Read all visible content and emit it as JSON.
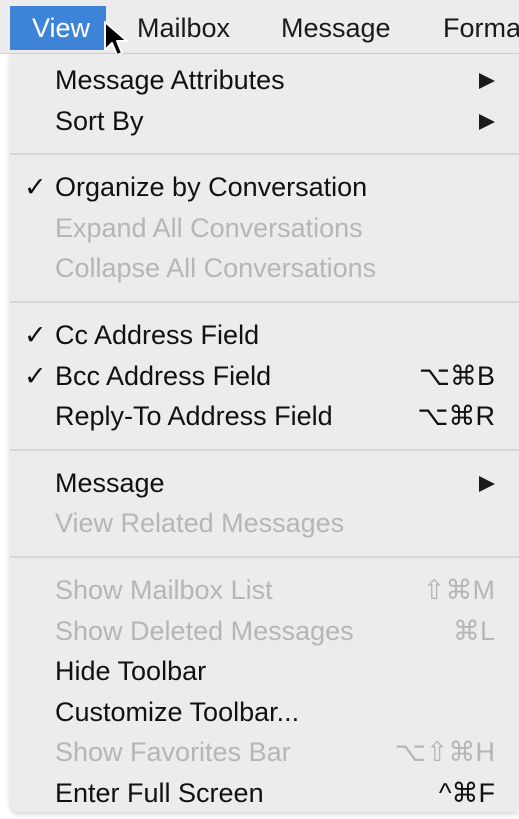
{
  "menubar": {
    "items": [
      "View",
      "Mailbox",
      "Message",
      "Forma"
    ]
  },
  "menu": {
    "sections": [
      [
        {
          "label": "Message Attributes",
          "submenu": true,
          "enabled": true
        },
        {
          "label": "Sort By",
          "submenu": true,
          "enabled": true
        }
      ],
      [
        {
          "label": "Organize by Conversation",
          "checked": true,
          "enabled": true
        },
        {
          "label": "Expand All Conversations",
          "enabled": false
        },
        {
          "label": "Collapse All Conversations",
          "enabled": false
        }
      ],
      [
        {
          "label": "Cc Address Field",
          "checked": true,
          "enabled": true
        },
        {
          "label": "Bcc Address Field",
          "checked": true,
          "enabled": true,
          "shortcut": "⌥⌘B"
        },
        {
          "label": "Reply-To Address Field",
          "enabled": true,
          "shortcut": "⌥⌘R"
        }
      ],
      [
        {
          "label": "Message",
          "submenu": true,
          "enabled": true
        },
        {
          "label": "View Related Messages",
          "enabled": false
        }
      ],
      [
        {
          "label": "Show Mailbox List",
          "enabled": false,
          "shortcut": "⇧⌘M"
        },
        {
          "label": "Show Deleted Messages",
          "enabled": false,
          "shortcut": "⌘L"
        },
        {
          "label": "Hide Toolbar",
          "enabled": true
        },
        {
          "label": "Customize Toolbar...",
          "enabled": true
        },
        {
          "label": "Show Favorites Bar",
          "enabled": false,
          "shortcut": "⌥⇧⌘H"
        },
        {
          "label": "Enter Full Screen",
          "enabled": true,
          "shortcut": "^⌘F"
        }
      ]
    ],
    "check_glyph": "✓"
  },
  "colors": {
    "highlight": "#3d84d8",
    "menu_bg": "#ececec",
    "disabled_text": "#b6b6b6"
  },
  "icons": {
    "cursor": "arrow-pointer-icon",
    "submenu": "submenu-triangle-icon",
    "check": "checkmark-icon"
  }
}
